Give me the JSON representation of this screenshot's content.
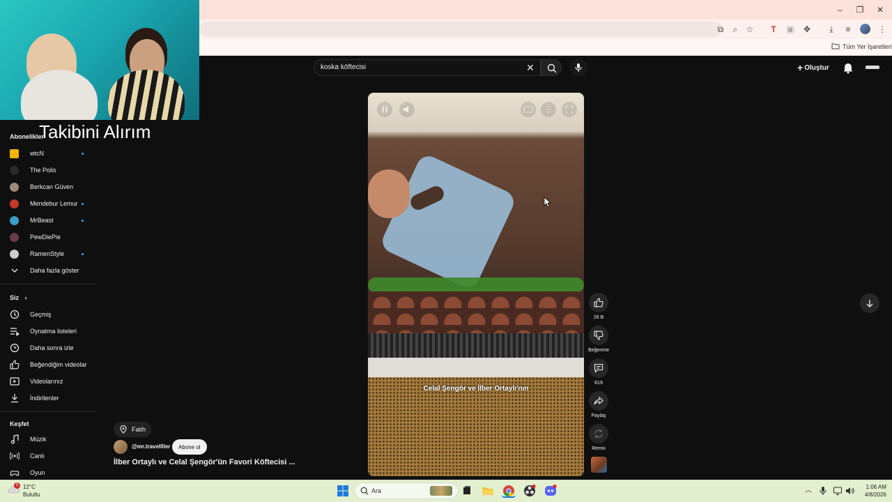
{
  "overlay": {
    "caption": "Takibini Alırım"
  },
  "browser": {
    "bookmarks_all": "Tüm Yer İşaretleri"
  },
  "header": {
    "search_value": "koska köftecisi",
    "create_label": "Oluştur"
  },
  "sidebar": {
    "subscriptions_heading": "Abonelikler",
    "subscriptions": [
      {
        "name": "wtcN",
        "live": true,
        "color": "#f2b400"
      },
      {
        "name": "The Polis",
        "live": false,
        "color": "#2a2a2a"
      },
      {
        "name": "Berkcan Güven",
        "live": false,
        "color": "#9a8a7a"
      },
      {
        "name": "Mendebur Lemur",
        "live": true,
        "color": "#c0392b"
      },
      {
        "name": "MrBeast",
        "live": true,
        "color": "#3aa0c8"
      },
      {
        "name": "PewDiePie",
        "live": false,
        "color": "#6a3a4a"
      },
      {
        "name": "RamenStyle",
        "live": true,
        "color": "#cccccc"
      }
    ],
    "show_more": "Daha fazla göster",
    "you_heading": "Siz",
    "you_items": [
      {
        "label": "Geçmiş",
        "icon": "history-icon"
      },
      {
        "label": "Oynatma listeleri",
        "icon": "playlists-icon"
      },
      {
        "label": "Daha sonra izle",
        "icon": "watch-later-icon"
      },
      {
        "label": "Beğendiğim videolar",
        "icon": "liked-icon"
      },
      {
        "label": "Videolarınız",
        "icon": "your-videos-icon"
      },
      {
        "label": "İndirilenler",
        "icon": "downloads-icon"
      }
    ],
    "explore_heading": "Keşfet",
    "explore_items": [
      {
        "label": "Müzik",
        "icon": "music-icon"
      },
      {
        "label": "Canlı",
        "icon": "live-icon"
      },
      {
        "label": "Oyun",
        "icon": "gaming-icon"
      }
    ]
  },
  "video": {
    "subtitle": "Celal Şengör ve İlber Ortaylı'nın",
    "location": "Fatih",
    "channel": "@mr.travellller",
    "subscribe_label": "Abone ol",
    "title": "İlber Ortaylı ve Celal Şengör'ün Favori Köftecisi ..."
  },
  "actions": {
    "likes": "26 B",
    "dislike_label": "Beğenme",
    "comments": "619",
    "share_label": "Paylaş",
    "remix_label": "Remix"
  },
  "taskbar": {
    "temperature": "12°C",
    "weather": "Bulutlu",
    "weather_badge": "3",
    "search_label": "Ara",
    "time": "1:06 AM",
    "date": "4/8/2026"
  }
}
